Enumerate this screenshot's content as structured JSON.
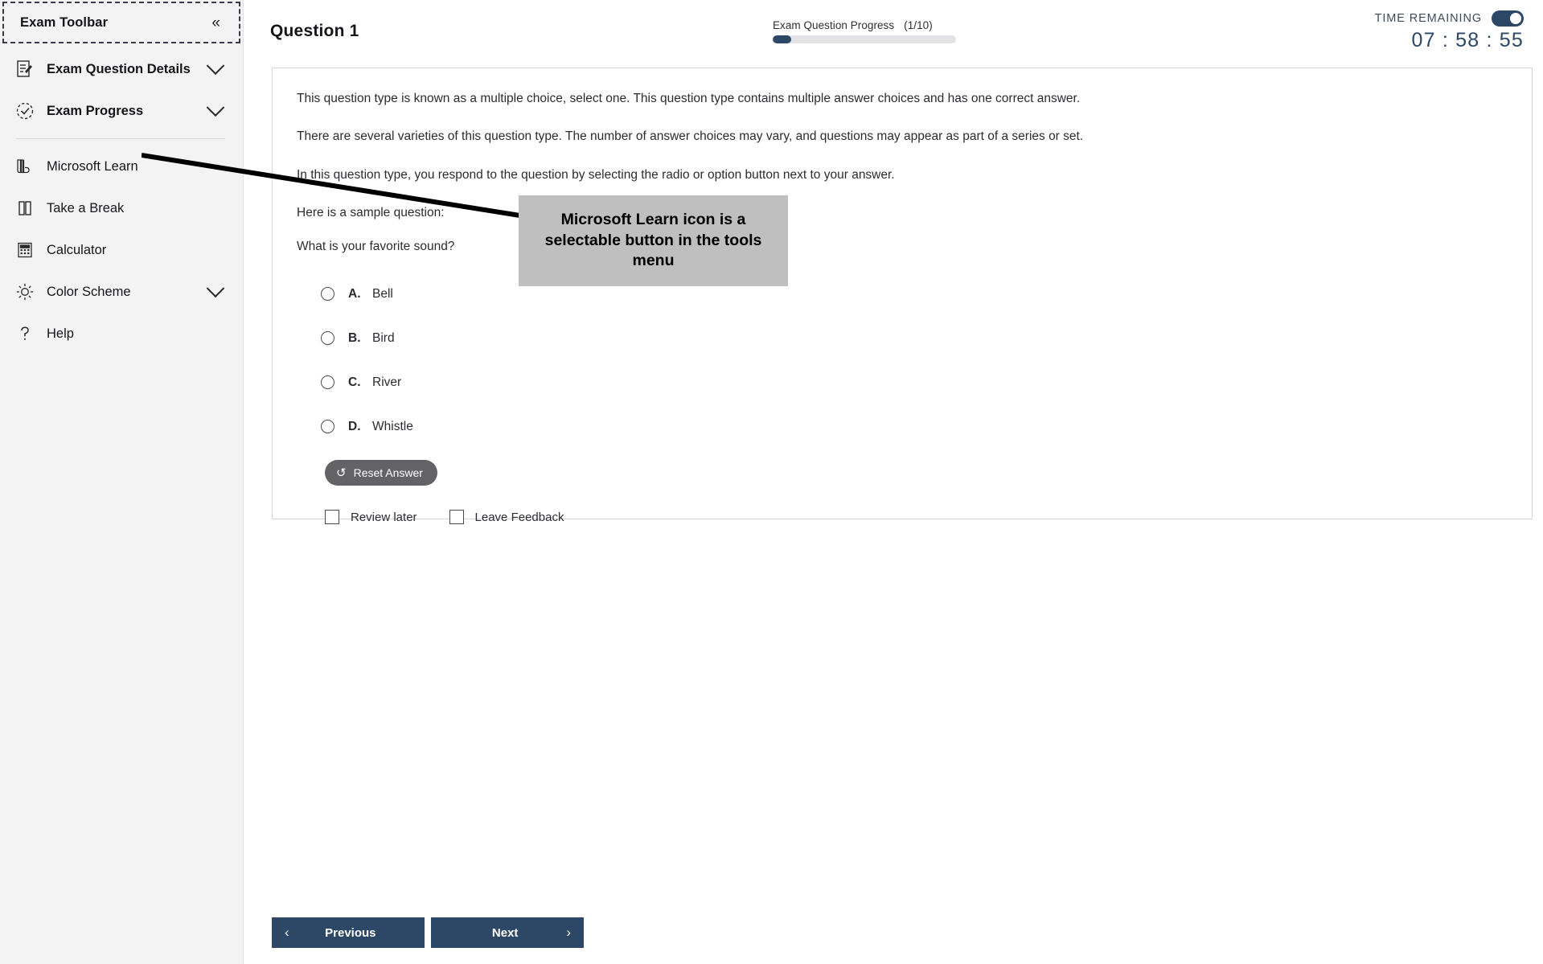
{
  "sidebar": {
    "title": "Exam Toolbar",
    "collapse_icon": "chevron-double-left-icon",
    "collapse_glyph": "«",
    "items": [
      {
        "label": "Exam Question Details",
        "icon": "document-edit-icon",
        "chevron": true
      },
      {
        "label": "Exam Progress",
        "icon": "progress-check-icon",
        "chevron": true
      },
      {
        "label": "Microsoft Learn",
        "icon": "books-icon",
        "chevron": false
      },
      {
        "label": "Take a Break",
        "icon": "pause-icon",
        "chevron": false
      },
      {
        "label": "Calculator",
        "icon": "calculator-icon",
        "chevron": false
      },
      {
        "label": "Color Scheme",
        "icon": "sun-icon",
        "chevron": true
      },
      {
        "label": "Help",
        "icon": "question-mark-icon",
        "chevron": false
      }
    ]
  },
  "header": {
    "question_title": "Question 1",
    "progress_label": "Exam Question Progress",
    "progress_count": "(1/10)",
    "progress_percent": 10,
    "timer_label": "TIME REMAINING",
    "timer_value": "07 : 58 : 55",
    "toggle_on": true
  },
  "content": {
    "paragraphs": [
      "This question type is known as a multiple choice, select one. This question type contains multiple answer choices and has one correct answer.",
      "There are several varieties of this question type. The number of answer choices may vary, and questions may appear as part of a series or set.",
      "In this question type, you respond to the question by selecting the radio or option button next to your answer.",
      "Here is a sample question:"
    ],
    "question_text": "What is your favorite sound?",
    "options": [
      {
        "letter": "A.",
        "text": "Bell"
      },
      {
        "letter": "B.",
        "text": "Bird"
      },
      {
        "letter": "C.",
        "text": "River"
      },
      {
        "letter": "D.",
        "text": "Whistle"
      }
    ],
    "reset_label": "Reset Answer",
    "reset_icon": "undo-icon",
    "reset_glyph": "↺",
    "checkboxes": [
      {
        "label": "Review later",
        "checked": false
      },
      {
        "label": "Leave Feedback",
        "checked": false
      }
    ]
  },
  "annotation": {
    "text": "Microsoft Learn icon is a selectable button in the tools menu"
  },
  "footer": {
    "previous_label": "Previous",
    "previous_icon": "chevron-left-icon",
    "previous_glyph": "‹",
    "next_label": "Next",
    "next_icon": "chevron-right-icon",
    "next_glyph": "›"
  },
  "colors": {
    "accent_navy": "#2c4866",
    "sidebar_bg": "#f3f3f4",
    "annotation_bg": "#bfbfbf",
    "reset_gray": "#636366"
  }
}
